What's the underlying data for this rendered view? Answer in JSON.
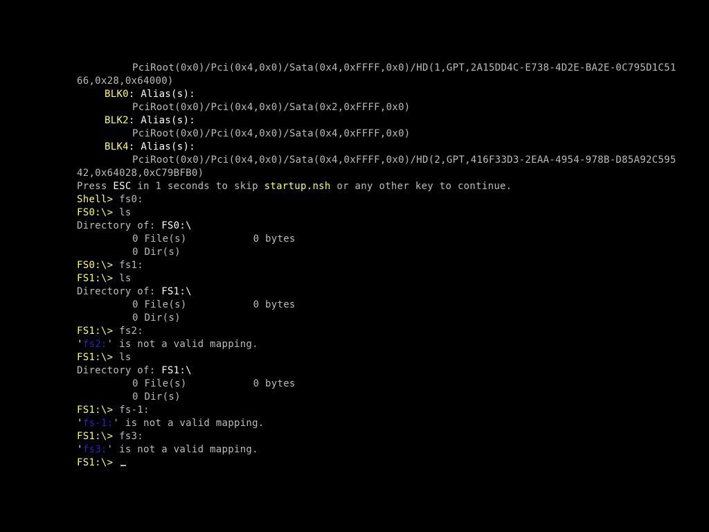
{
  "colors": {
    "background": "#000000",
    "text": "#bcbcbc",
    "highlight": "#ffff55",
    "emphasis": "#ffffff",
    "error_token": "#2222cc"
  },
  "mapping": {
    "hd1_path": "PciRoot(0x0)/Pci(0x4,0x0)/Sata(0x4,0xFFFF,0x0)/HD(1,GPT,2A15DD4C-E738-4D2E-BA2E-0C795D1C51",
    "hd1_path_wrap": "66,0x28,0x64000)",
    "blk0_name": "BLK0",
    "blk0_alias": ": Alias(s):",
    "blk0_path": "PciRoot(0x0)/Pci(0x4,0x0)/Sata(0x2,0xFFFF,0x0)",
    "blk2_name": "BLK2",
    "blk2_alias": ": Alias(s):",
    "blk2_path": "PciRoot(0x0)/Pci(0x4,0x0)/Sata(0x4,0xFFFF,0x0)",
    "blk4_name": "BLK4",
    "blk4_alias": ": Alias(s):",
    "hd2_path": "PciRoot(0x0)/Pci(0x4,0x0)/Sata(0x4,0xFFFF,0x0)/HD(2,GPT,416F33D3-2EAA-4954-978B-D85A92C595",
    "hd2_path_wrap": "42,0x64028,0xC79BFB0)"
  },
  "startup": {
    "pre": "Press ",
    "esc": "ESC",
    "mid": " in 1 seconds to skip ",
    "file": "startup.nsh",
    "post": " or any other key to continue."
  },
  "session": {
    "shell_prompt": "Shell>",
    "cmd_fs0": " fs0:",
    "fs0_prompt": "FS0:\\>",
    "cmd_ls": " ls",
    "dir_label": "Directory of: ",
    "fs0_dir": "FS0:\\",
    "files_count": "0 File(s)",
    "bytes": "0 bytes",
    "dirs_count": "0 Dir(s)",
    "cmd_fs1": " fs1:",
    "fs1_prompt": "FS1:\\>",
    "fs1_dir": "FS1:\\",
    "cmd_fs2": " fs2:",
    "quote_open": "'",
    "bad_fs2": "fs2:",
    "invalid_msg": "' is not a valid mapping.",
    "cmd_fsm1": " fs-1:",
    "bad_fsm1": "fs-1:",
    "cmd_fs3": " fs3:",
    "bad_fs3": "fs3:"
  }
}
